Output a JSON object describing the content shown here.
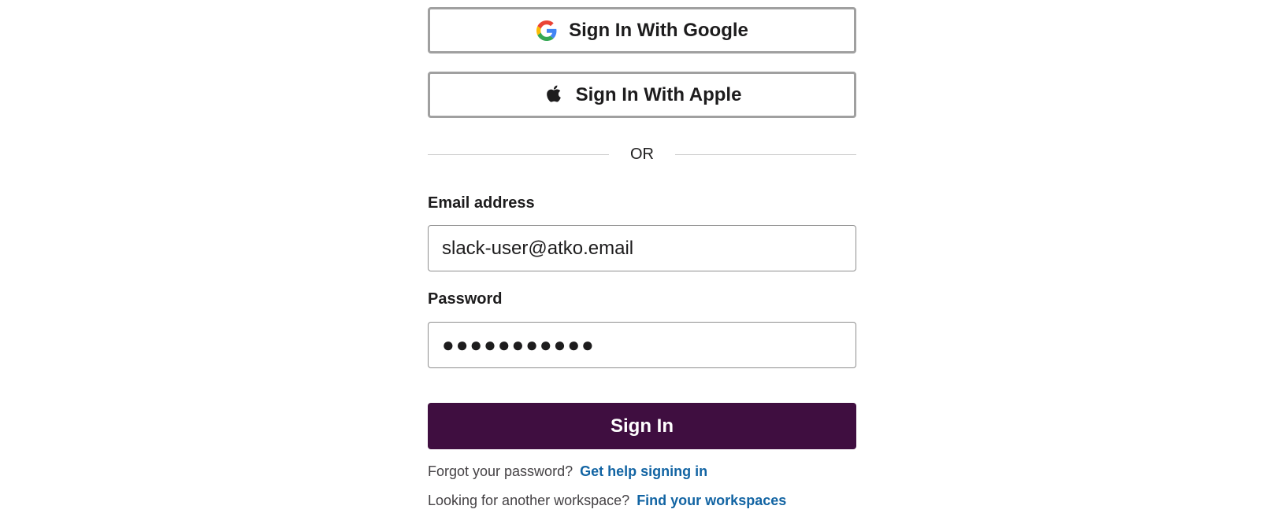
{
  "social": {
    "google_label": "Sign In With Google",
    "apple_label": "Sign In With Apple",
    "google_icon": "google-g-logo",
    "apple_icon": "apple-logo"
  },
  "divider": {
    "text": "OR"
  },
  "email": {
    "label": "Email address",
    "value": "slack-user@atko.email"
  },
  "password": {
    "label": "Password",
    "value": "●●●●●●●●●●●"
  },
  "submit": {
    "label": "Sign In"
  },
  "help": {
    "forgot_text": "Forgot your password?",
    "forgot_link": "Get help signing in",
    "workspace_text": "Looking for another workspace?",
    "workspace_link": "Find your workspaces"
  },
  "colors": {
    "primary_button": "#3f0e40",
    "link": "#1264a3",
    "border": "#a0a0a0"
  }
}
